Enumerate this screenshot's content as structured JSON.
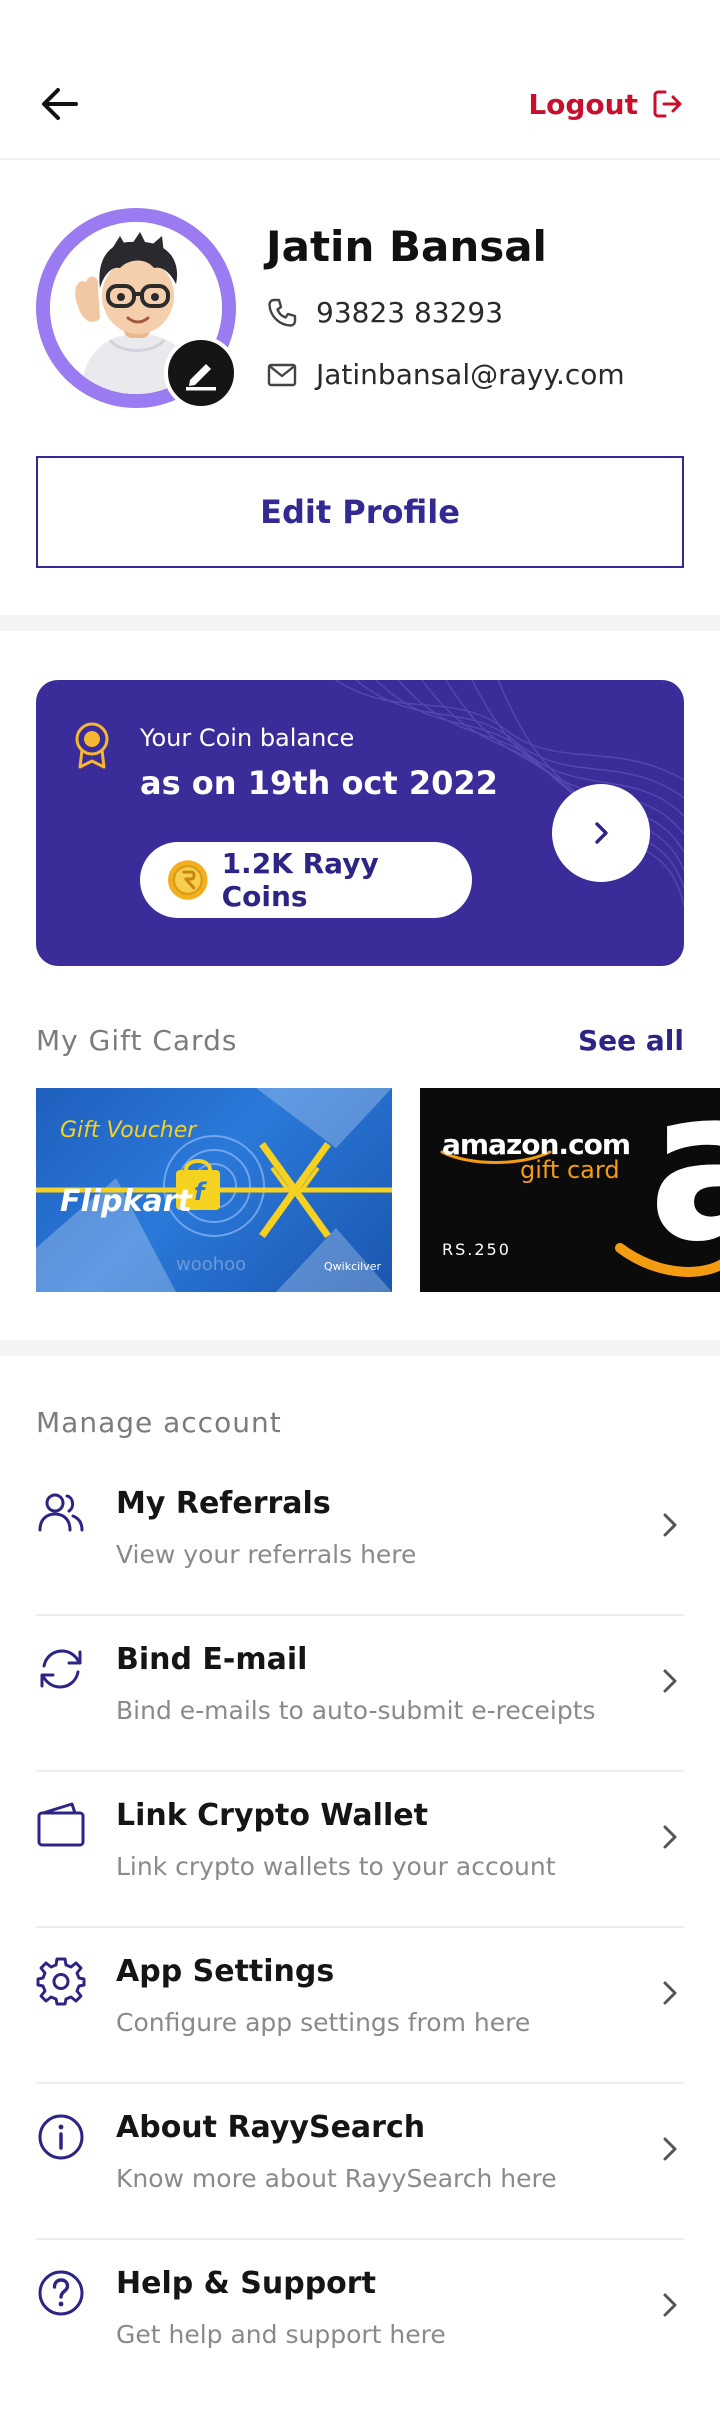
{
  "header": {
    "logout_label": "Logout"
  },
  "profile": {
    "name": "Jatin Bansal",
    "phone": "93823 83293",
    "email": "Jatinbansal@rayy.com",
    "edit_button": "Edit Profile"
  },
  "coin_card": {
    "label": "Your Coin balance",
    "date_text": "as on 19th oct 2022",
    "amount": "1.2K Rayy Coins"
  },
  "gift_cards": {
    "title": "My Gift Cards",
    "see_all": "See all",
    "cards": [
      {
        "brand": "Flipkart",
        "heading": "Gift Voucher",
        "partner": "woohoo",
        "issuer": "Qwikcilver"
      },
      {
        "brand": "amazon.com",
        "subtitle": "gift card",
        "value": "RS.250"
      }
    ]
  },
  "manage_account": {
    "title": "Manage account",
    "items": [
      {
        "title": "My Referrals",
        "subtitle": "View your referrals here",
        "icon": "users-icon"
      },
      {
        "title": "Bind E-mail",
        "subtitle": "Bind e-mails to auto-submit e-receipts",
        "icon": "refresh-icon"
      },
      {
        "title": "Link Crypto Wallet",
        "subtitle": "Link crypto wallets to your account",
        "icon": "wallet-icon"
      },
      {
        "title": "App Settings",
        "subtitle": "Configure app settings from here",
        "icon": "gear-icon"
      },
      {
        "title": "About RayySearch",
        "subtitle": "Know more about RayySearch here",
        "icon": "info-icon"
      },
      {
        "title": "Help & Support",
        "subtitle": "Get help and support here",
        "icon": "help-icon"
      }
    ]
  },
  "colors": {
    "brand_primary": "#322a92",
    "logout_red": "#c8102e",
    "avatar_ring": "#9b7bf2",
    "coin_card_bg": "#3a2c99"
  }
}
